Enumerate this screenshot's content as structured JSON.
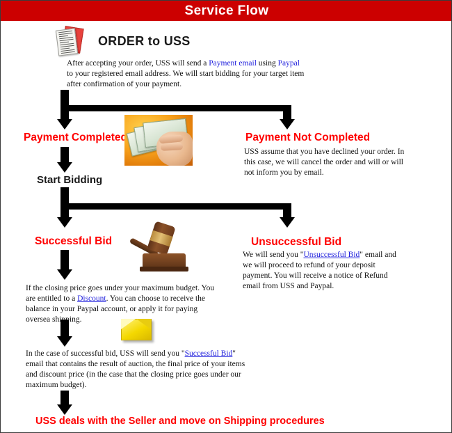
{
  "header": {
    "title": "Service Flow",
    "bar_color": "#cc0000",
    "title_color": "#ffffff"
  },
  "colors": {
    "heading_red": "#ff0000",
    "link_blue": "#2222dd",
    "body_black": "#111111"
  },
  "steps": {
    "order": {
      "icon": "order-documents-icon",
      "heading": "ORDER to USS",
      "body_parts": [
        {
          "text": "After accepting your order, USS will send a ",
          "style": "plain"
        },
        {
          "text": "Payment email",
          "style": "link"
        },
        {
          "text": " using ",
          "style": "plain"
        },
        {
          "text": "Paypal",
          "style": "link"
        },
        {
          "text": " to your registered email address. We will start bidding for your target item after confirmation of your payment.",
          "style": "plain"
        }
      ]
    },
    "payment_completed": {
      "heading": "Payment Completed"
    },
    "payment_not_completed": {
      "heading": "Payment Not Completed",
      "body_parts": [
        {
          "text": "USS assume that you have declined your order. In this case, we will cancel the order and will or will not inform you by email.",
          "style": "plain"
        }
      ]
    },
    "start_bidding": {
      "heading": "Start Bidding"
    },
    "successful_bid": {
      "heading": "Successful Bid",
      "body_parts": [
        {
          "text": "If the closing price goes under your maximum budget. You are entitled to a ",
          "style": "plain"
        },
        {
          "text": "Discount",
          "style": "link-underline"
        },
        {
          "text": ". You can choose to receive the balance in your Paypal account, or apply it for paying oversea shipping.",
          "style": "plain"
        }
      ]
    },
    "unsuccessful_bid": {
      "heading": "Unsuccessful Bid",
      "body_parts": [
        {
          "text": "We will send you \"",
          "style": "plain"
        },
        {
          "text": "Unsuccessful Bid",
          "style": "link-underline"
        },
        {
          "text": "\" email and we will proceed to refund of your deposit payment. You will receive a notice of Refund email from USS and Paypal.",
          "style": "plain"
        }
      ]
    },
    "success_email": {
      "icon": "envelope-icon",
      "body_parts": [
        {
          "text": "In the case of successful bid, USS will send you \"",
          "style": "plain"
        },
        {
          "text": "Successful Bid",
          "style": "link-underline"
        },
        {
          "text": "\" email that contains the result of auction, the final price of your items and discount price (in the case that the closing price goes under our maximum budget).",
          "style": "plain"
        }
      ]
    },
    "final": {
      "heading": "USS deals with the Seller and move on Shipping procedures"
    }
  },
  "images": {
    "money": "hand-holding-money-image",
    "gavel": "auction-gavel-image"
  }
}
